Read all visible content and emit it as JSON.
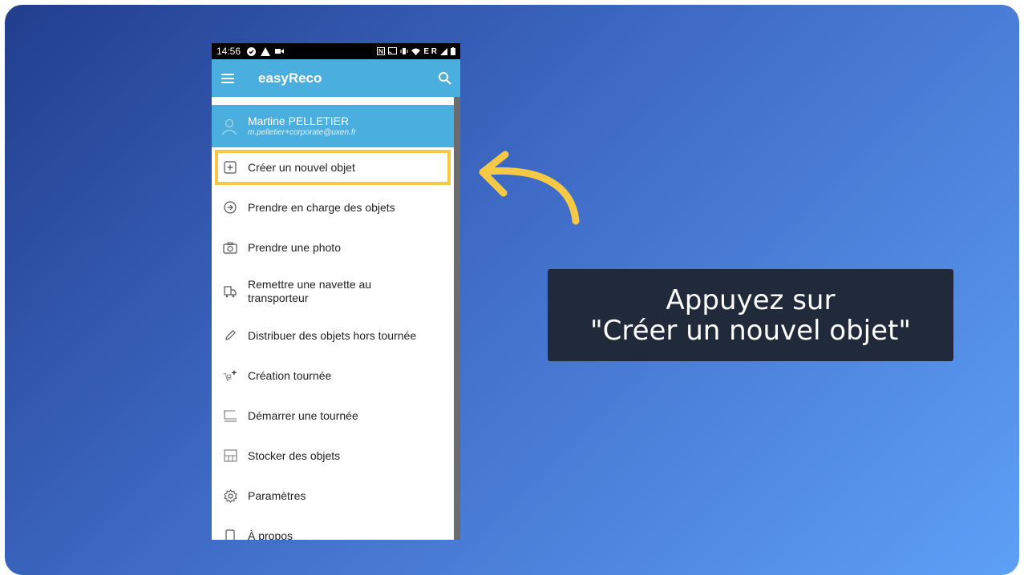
{
  "status_bar": {
    "time": "14:56",
    "right_indicators": "E R"
  },
  "app_bar": {
    "title": "easyReco",
    "menu_icon": "hamburger-icon",
    "search_icon": "search-icon"
  },
  "drawer": {
    "user": {
      "name": "Martine PELLETIER",
      "email": "m.pelletier+corporate@uxen.fr"
    },
    "items": [
      {
        "label": "Créer un nouvel objet",
        "icon": "add-document-icon"
      },
      {
        "label": "Prendre en charge des objets",
        "icon": "arrow-circle-icon"
      },
      {
        "label": "Prendre une photo",
        "icon": "camera-icon"
      },
      {
        "label": "Remettre une navette au transporteur",
        "icon": "truck-icon"
      },
      {
        "label": "Distribuer des objets hors tournée",
        "icon": "pen-icon"
      },
      {
        "label": "Création tournée",
        "icon": "cart-plus-icon"
      },
      {
        "label": "Démarrer une tournée",
        "icon": "trolley-icon"
      },
      {
        "label": "Stocker des objets",
        "icon": "storage-icon"
      },
      {
        "label": "Paramètres",
        "icon": "gear-icon"
      },
      {
        "label": "À propos",
        "icon": "phone-icon"
      }
    ]
  },
  "callout": {
    "line1": "Appuyez sur",
    "line2": "\"Créer un nouvel objet\""
  },
  "colors": {
    "accent": "#4aaede",
    "highlight": "#f6c945",
    "callout_bg": "#212a3a"
  }
}
